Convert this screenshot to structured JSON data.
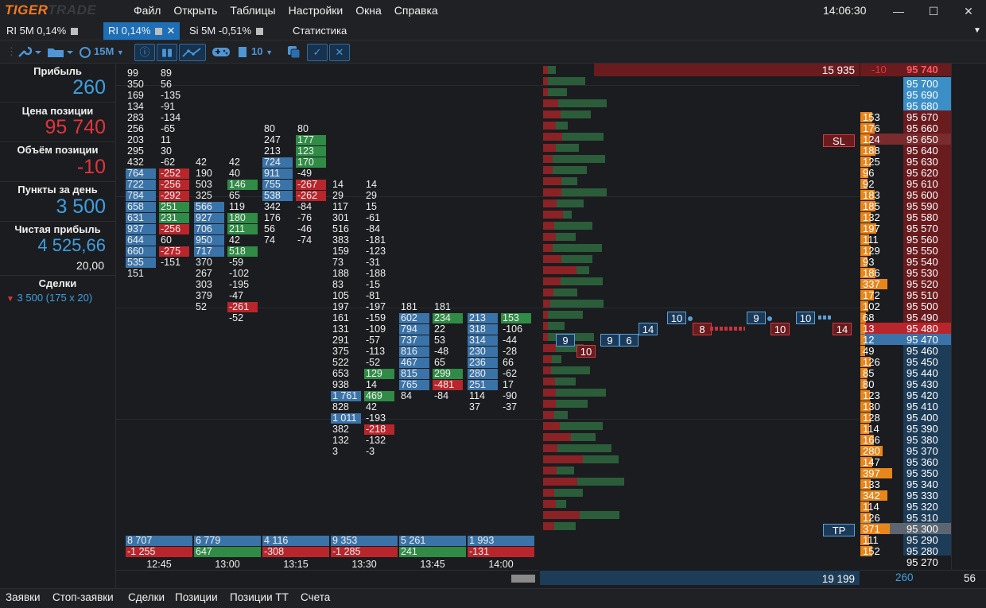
{
  "app": {
    "logo_a": "TIGER",
    "logo_b": "TRADE",
    "menu": [
      "Файл",
      "Открыть",
      "Таблицы",
      "Настройки",
      "Окна",
      "Справка"
    ],
    "clock": "14:06:30",
    "window_controls": [
      "minimize-icon",
      "maximize-icon",
      "close-icon"
    ]
  },
  "tabs": [
    {
      "label": "RI 5M 0,14%"
    },
    {
      "label": "RI 0,14%",
      "active": true
    },
    {
      "label": "Si 5M -0,51%"
    },
    {
      "label": "Статистика"
    }
  ],
  "toolbar": {
    "timeframe": "15M",
    "count": "10"
  },
  "sidebar": {
    "profit_label": "Прибыль",
    "profit_value": "260",
    "position_price_label": "Цена позиции",
    "position_price_value": "95 740",
    "position_volume_label": "Объём позиции",
    "position_volume_value": "-10",
    "points_label": "Пункты за день",
    "points_value": "3 500",
    "net_profit_label": "Чистая прибыль",
    "net_profit_value": "4 525,66",
    "commission_value": "20,00",
    "deals_label": "Сделки",
    "deals_value": "3 500 (175 x 20)"
  },
  "clusters": [
    {
      "time": "12:45",
      "top_row": 0,
      "vol": [
        "99",
        "350",
        "169",
        "134",
        "283",
        "256",
        "203",
        "295",
        "432",
        "764",
        "722",
        "784",
        "658",
        "631",
        "937",
        "644",
        "660",
        "535",
        "151"
      ],
      "delta": [
        "89",
        "56",
        "-135",
        "-91",
        "-134",
        "-65",
        "11",
        "30",
        "-62",
        "-252",
        "-256",
        "-292",
        "251",
        "231",
        "-256",
        "60",
        "-275",
        "-151"
      ],
      "sum_vol": "8 707",
      "sum_delta": "-1 255"
    },
    {
      "time": "13:00",
      "top_row": 8,
      "vol": [
        "42",
        "190",
        "503",
        "325",
        "566",
        "927",
        "706",
        "950",
        "717",
        "370",
        "267",
        "303",
        "379",
        "52"
      ],
      "delta": [
        "42",
        "40",
        "146",
        "65",
        "119",
        "180",
        "211",
        "42",
        "518",
        "-59",
        "-102",
        "-195",
        "-47",
        "-261",
        "-52"
      ],
      "sum_vol": "6 779",
      "sum_delta": "647"
    },
    {
      "time": "13:15",
      "top_row": 5,
      "vol": [
        "80",
        "247",
        "213",
        "724",
        "911",
        "755",
        "538",
        "342",
        "176",
        "56",
        "74"
      ],
      "delta": [
        "80",
        "177",
        "123",
        "170",
        "-49",
        "-267",
        "-262",
        "-84",
        "-76",
        "-46",
        "-74"
      ],
      "sum_vol": "4 116",
      "sum_delta": "-308"
    },
    {
      "time": "13:30",
      "top_row": 10,
      "vol": [
        "14",
        "29",
        "117",
        "301",
        "516",
        "383",
        "159",
        "73",
        "188",
        "83",
        "105",
        "197",
        "161",
        "131",
        "291",
        "375",
        "522",
        "653",
        "938",
        "1 761",
        "828",
        "1 011",
        "382",
        "132",
        "3"
      ],
      "delta": [
        "14",
        "29",
        "15",
        "-61",
        "-84",
        "-181",
        "-123",
        "-31",
        "-188",
        "-15",
        "-81",
        "-197",
        "-159",
        "-109",
        "-57",
        "-113",
        "-52",
        "129",
        "14",
        "469",
        "42",
        "-193",
        "-218",
        "-132",
        "-3"
      ],
      "sum_vol": "9 353",
      "sum_delta": "-1 285"
    },
    {
      "time": "13:45",
      "top_row": 21,
      "vol": [
        "181",
        "602",
        "794",
        "737",
        "816",
        "467",
        "815",
        "765",
        "84"
      ],
      "delta": [
        "181",
        "234",
        "22",
        "53",
        "-48",
        "65",
        "299",
        "-481",
        "-84"
      ],
      "sum_vol": "5 261",
      "sum_delta": "241"
    },
    {
      "time": "14:00",
      "top_row": 22,
      "vol": [
        "213",
        "318",
        "314",
        "230",
        "236",
        "280",
        "251",
        "114",
        "37"
      ],
      "delta": [
        "153",
        "-106",
        "-44",
        "-28",
        "66",
        "-62",
        "17",
        "-90",
        "-37"
      ],
      "sum_vol": "1 993",
      "sum_delta": "-131"
    }
  ],
  "profile": {
    "top_value": "15 935",
    "bottom_value": "19 199"
  },
  "ladder": {
    "header_left": "-10",
    "header_price": "95 740",
    "prices": [
      "95 700",
      "95 690",
      "95 680",
      "95 670",
      "95 660",
      "95 650",
      "95 640",
      "95 630",
      "95 620",
      "95 610",
      "95 600",
      "95 590",
      "95 580",
      "95 570",
      "95 560",
      "95 550",
      "95 540",
      "95 530",
      "95 520",
      "95 510",
      "95 500",
      "95 490",
      "95 480",
      "95 470",
      "95 460",
      "95 450",
      "95 440",
      "95 430",
      "95 420",
      "95 410",
      "95 400",
      "95 390",
      "95 380",
      "95 370",
      "95 360",
      "95 350",
      "95 340",
      "95 330",
      "95 320",
      "95 310",
      "95 300",
      "95 290",
      "95 280",
      "95 270"
    ],
    "sizes": [
      "",
      "",
      "",
      "153",
      "176",
      "124",
      "188",
      "125",
      "96",
      "92",
      "183",
      "185",
      "132",
      "197",
      "111",
      "129",
      "93",
      "186",
      "337",
      "172",
      "102",
      "68",
      "13",
      "12",
      "49",
      "126",
      "85",
      "80",
      "123",
      "130",
      "128",
      "114",
      "166",
      "280",
      "147",
      "397",
      "133",
      "342",
      "114",
      "126",
      "371",
      "111",
      "152",
      ""
    ],
    "sl_label": "SL",
    "tp_label": "TP",
    "footer_value": "260",
    "footer_right": "56"
  },
  "trade_markers": [
    "9",
    "10",
    "9",
    "6",
    "14",
    "10",
    "8",
    "9",
    "10",
    "10",
    "14"
  ],
  "bottom_tabs": [
    "Заявки",
    "Стоп-заявки",
    "Сделки",
    "Позиции",
    "Позиции ТТ",
    "Счета"
  ],
  "colors": {
    "accent_blue": "#3ea0e0",
    "accent_red": "#e0353c",
    "buy_cell": "#3a73a8",
    "sell_cell": "#b8262c",
    "green_cell": "#2f8b45",
    "orange": "#e8861c"
  }
}
